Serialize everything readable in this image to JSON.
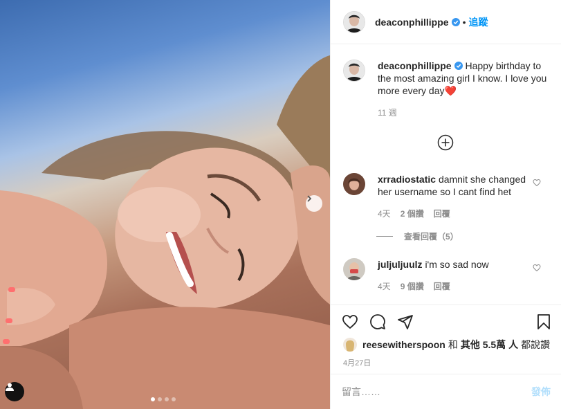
{
  "header": {
    "username": "deaconphillippe",
    "separator": "•",
    "follow_label": "追蹤"
  },
  "caption": {
    "username": "deaconphillippe",
    "text": "Happy birthday to the most amazing girl I know. I love you more every day",
    "emoji": "❤️",
    "time": "11 週"
  },
  "comments": [
    {
      "username": "xrradiostatic",
      "text": "damnit she changed her username so I cant find het",
      "time": "4天",
      "likes": "2 個讚",
      "reply_label": "回覆"
    },
    {
      "username": "juljuljuulz",
      "text": "i'm so sad now",
      "time": "4天",
      "likes": "9 個讚",
      "reply_label": "回覆"
    }
  ],
  "view_replies_label": "查看回覆（5）",
  "likes": {
    "username": "reesewitherspoon",
    "connector": "和",
    "others": "其他 5.5萬 人",
    "suffix": "都說讚"
  },
  "post_date": "4月27日",
  "comment_input": {
    "placeholder": "留言……",
    "post_label": "發佈"
  },
  "carousel": {
    "total": 4,
    "active": 1
  },
  "colors": {
    "link_blue": "#0095f6",
    "muted": "#8e8e8e",
    "post_disabled": "#b2dffc",
    "heart_red": "#ed4956"
  },
  "icons": [
    "verified-badge-icon",
    "next-arrow-icon",
    "user-tag-icon",
    "add-circle-icon",
    "heart-icon",
    "comment-icon",
    "share-icon",
    "save-icon"
  ]
}
